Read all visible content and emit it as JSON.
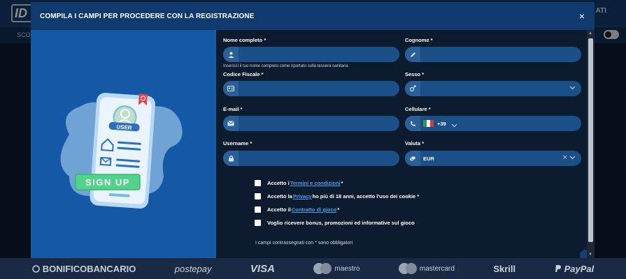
{
  "background": {
    "logo": "ID",
    "header_right": "ATI",
    "subnav_item": "SCO"
  },
  "modal": {
    "title": "COMPILA I CAMPI PER PROCEDERE CON LA REGISTRAZIONE",
    "close_label": "×"
  },
  "illustration": {
    "user_badge": "USER",
    "signup_label": "SIGN UP"
  },
  "form": {
    "nome": {
      "label": "Nome completo *",
      "value": "",
      "hint": "Inserisci il tuo nome completo come riportato sulla tessera sanitaria"
    },
    "cognome": {
      "label": "Cognome *",
      "value": ""
    },
    "codice_fiscale": {
      "label": "Codice Fiscale *",
      "value": ""
    },
    "sesso": {
      "label": "Sesso *",
      "value": ""
    },
    "email": {
      "label": "E-mail *",
      "value": ""
    },
    "cellulare": {
      "label": "Cellulare *",
      "prefix": "+39",
      "value": ""
    },
    "username": {
      "label": "Username *",
      "value": ""
    },
    "valuta": {
      "label": "Valuta *",
      "value": "EUR",
      "clear": "×"
    },
    "checkboxes": [
      {
        "pre": "Accetto i ",
        "link": "Termini e condizioni",
        "post": " *"
      },
      {
        "pre": "Accetto la ",
        "link": "Privacy",
        "post": " ho più di 18 anni, accetto l'uso dei cookie *"
      },
      {
        "pre": "Accetto il ",
        "link": "Contratto di gioco",
        "post": " *"
      },
      {
        "pre": "Voglio ricevere bonus, promozioni ed informative sul gioco",
        "link": "",
        "post": ""
      }
    ],
    "required_note": "I campi contrassegnati con * sono obbligatori"
  },
  "payments": [
    {
      "name": "BONIFICOBANCARIO"
    },
    {
      "name": "postepay"
    },
    {
      "name": "VISA"
    },
    {
      "name": "maestro"
    },
    {
      "name": "mastercard"
    },
    {
      "name": "Skrill"
    },
    {
      "name": "PayPal"
    }
  ],
  "colors": {
    "modal_header": "#103a6d",
    "illustration_bg": "#1559a6",
    "field_bg": "#1a4f87",
    "link": "#4c9cf0"
  }
}
